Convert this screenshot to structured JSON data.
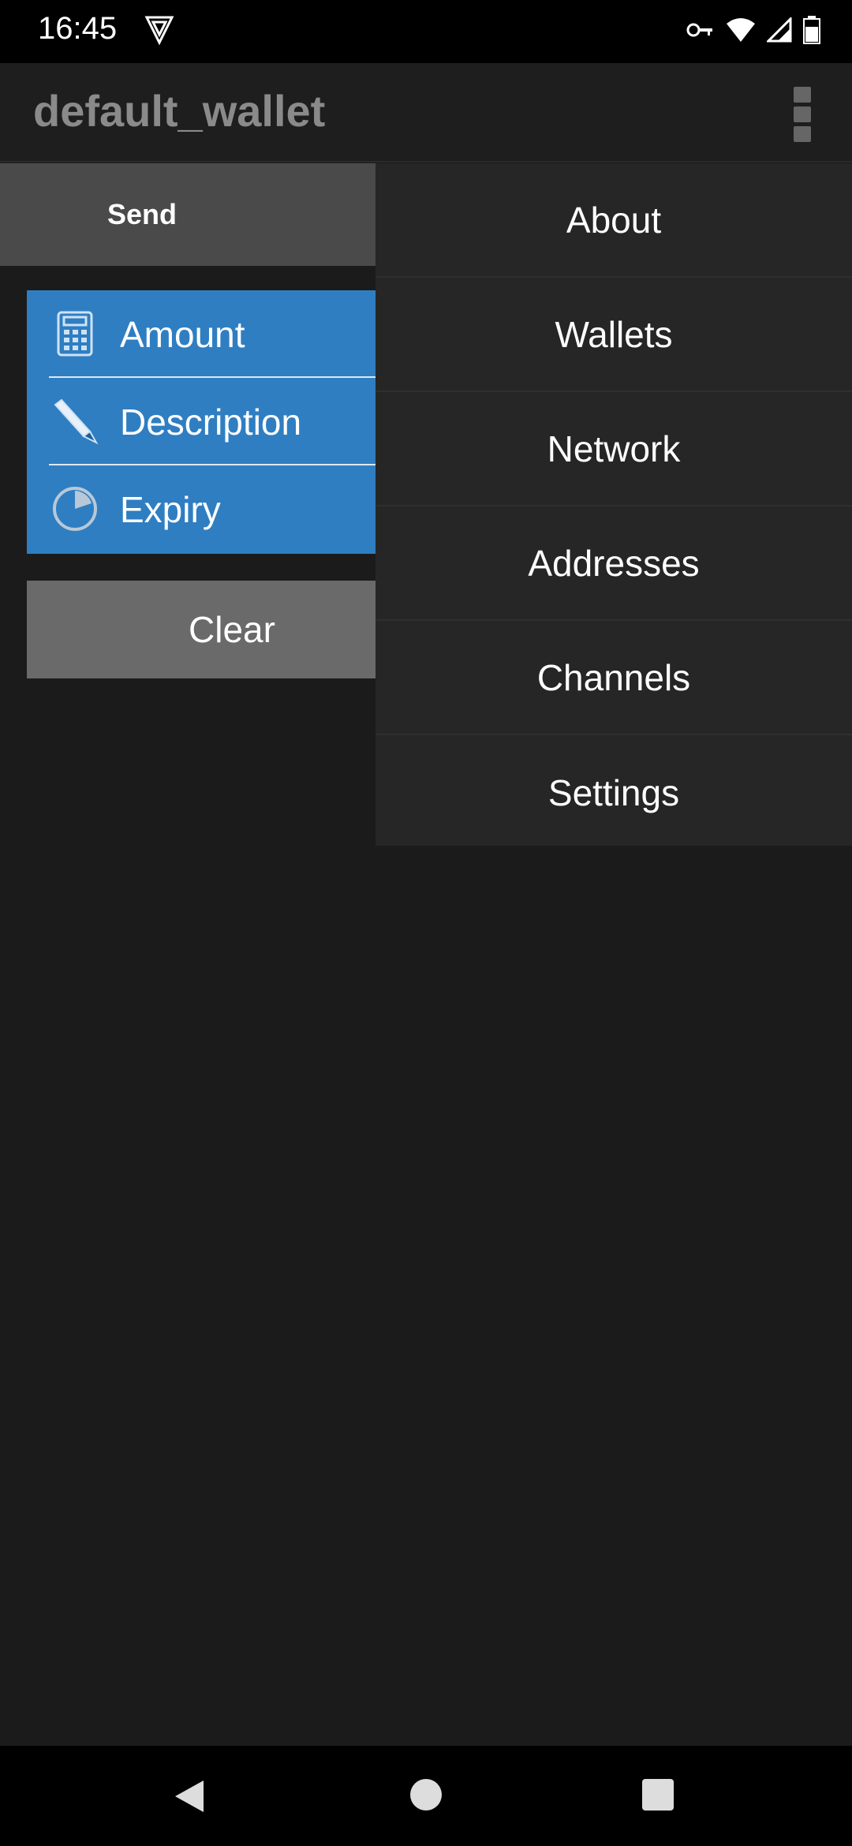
{
  "status_bar": {
    "time": "16:45",
    "icons": [
      "vpn-icon",
      "key-icon",
      "wifi-icon",
      "signal-icon",
      "battery-icon"
    ]
  },
  "action_bar": {
    "title": "default_wallet",
    "overflow_icon": "overflow-menu-icon"
  },
  "tabs": [
    {
      "label": "Send"
    }
  ],
  "fields": [
    {
      "label": "Amount",
      "icon": "calculator-icon"
    },
    {
      "label": "Description",
      "icon": "pen-icon"
    },
    {
      "label": "Expiry",
      "icon": "clock-pie-icon"
    }
  ],
  "clear_button": {
    "label": "Clear"
  },
  "menu": {
    "items": [
      {
        "label": "About"
      },
      {
        "label": "Wallets"
      },
      {
        "label": "Network"
      },
      {
        "label": "Addresses"
      },
      {
        "label": "Channels"
      },
      {
        "label": "Settings"
      }
    ]
  },
  "nav_bar": {
    "icons": [
      "back-icon",
      "home-icon",
      "recents-icon"
    ]
  },
  "colors": {
    "background": "#1b1b1b",
    "panel_blue": "#2f7ec2",
    "menu_bg": "#262626",
    "button_gray": "#6a6a6a"
  }
}
